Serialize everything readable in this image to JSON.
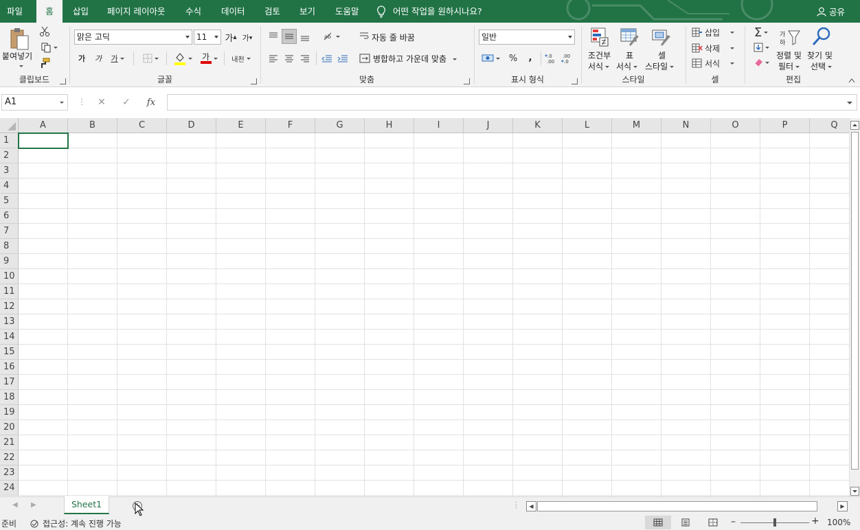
{
  "tabs": [
    {
      "label": "파일",
      "active": false
    },
    {
      "label": "홈",
      "active": true
    },
    {
      "label": "삽입",
      "active": false
    },
    {
      "label": "페이지 레이아웃",
      "active": false
    },
    {
      "label": "수식",
      "active": false
    },
    {
      "label": "데이터",
      "active": false
    },
    {
      "label": "검토",
      "active": false
    },
    {
      "label": "보기",
      "active": false
    },
    {
      "label": "도움말",
      "active": false
    }
  ],
  "tell_me": "어떤 작업을 원하시나요?",
  "share": "공유",
  "ribbon": {
    "clipboard": {
      "label": "클립보드",
      "paste": "붙여넣기"
    },
    "font": {
      "label": "글꼴",
      "font_name": "맑은 고딕",
      "font_size": "11",
      "bold": "가",
      "italic": "가",
      "underline": "가",
      "grow": "가",
      "shrink": "가",
      "font_color_glyph": "가",
      "phonetic": "내천"
    },
    "alignment": {
      "label": "맞춤",
      "wrap_text": "자동 줄 바꿈",
      "merge_center": "병합하고 가운데 맞춤"
    },
    "number": {
      "label": "표시 형식",
      "format": "일반",
      "percent": "%",
      "comma": ","
    },
    "styles": {
      "label": "스타일",
      "conditional_l1": "조건부",
      "conditional_l2": "서식",
      "table_l1": "표",
      "table_l2": "서식",
      "cell_l1": "셀",
      "cell_l2": "스타일"
    },
    "cells": {
      "label": "셀",
      "insert": "삽입",
      "delete": "삭제",
      "format": "서식"
    },
    "editing": {
      "label": "편집",
      "sort_l1": "정렬 및",
      "sort_l2": "필터",
      "find_l1": "찾기 및",
      "find_l2": "선택"
    }
  },
  "formula_bar": {
    "name_box": "A1",
    "fx": "fx",
    "formula": ""
  },
  "columns": [
    "A",
    "B",
    "C",
    "D",
    "E",
    "F",
    "G",
    "H",
    "I",
    "J",
    "K",
    "L",
    "M",
    "N",
    "O",
    "P",
    "Q"
  ],
  "rows": [
    "1",
    "2",
    "3",
    "4",
    "5",
    "6",
    "7",
    "8",
    "9",
    "10",
    "11",
    "12",
    "13",
    "14",
    "15",
    "16",
    "17",
    "18",
    "19",
    "20",
    "21",
    "22",
    "23",
    "24"
  ],
  "sheets": [
    {
      "name": "Sheet1",
      "active": true
    }
  ],
  "add_sheet": "+",
  "status": {
    "ready": "준비",
    "accessibility": "접근성: 계속 진행 가능",
    "zoom": "100%"
  },
  "colors": {
    "accent": "#217346",
    "ribbon_bg": "#f3f3f3"
  }
}
